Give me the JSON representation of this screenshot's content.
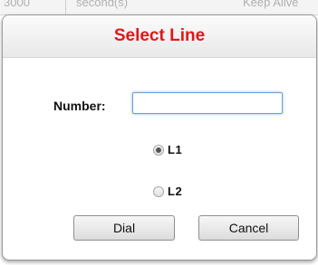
{
  "background_table": {
    "col1": "3000",
    "col2": "second(s)",
    "col3": "Keep Alive"
  },
  "dialog": {
    "title": "Select Line",
    "title_color": "#e01818",
    "number_label": "Number:",
    "number_value": "",
    "lines": [
      {
        "label": "L1",
        "selected": true
      },
      {
        "label": "L2",
        "selected": false
      }
    ],
    "dial_label": "Dial",
    "cancel_label": "Cancel"
  }
}
